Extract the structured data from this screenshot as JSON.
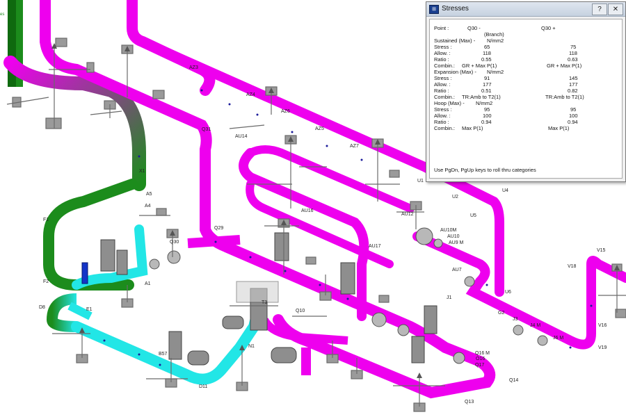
{
  "corner_text": "es",
  "window": {
    "title": "Stresses",
    "help_label": "?",
    "close_label": "✕"
  },
  "stress": {
    "point_label": "Point :",
    "point1": "Q30  -",
    "point2": "Q30  +",
    "branch": "(Branch)",
    "sustained_header": "Sustained (Max) -",
    "sustained_units": "N/mm2",
    "sustained": {
      "stress_label": "Stress :",
      "stress1": "65",
      "stress2": "75",
      "allow_label": "Allow. :",
      "allow1": "118",
      "allow2": "118",
      "ratio_label": "Ratio :",
      "ratio1": "0.55",
      "ratio2": "0.63",
      "combin_label": "Combin.:",
      "combin1": "GR + Max P(1)",
      "combin2": "GR + Max P(1)"
    },
    "expansion_header": "Expansion (Max) -",
    "expansion_units": "N/mm2",
    "expansion": {
      "stress_label": "Stress :",
      "stress1": "91",
      "stress2": "145",
      "allow_label": "Allow. :",
      "allow1": "177",
      "allow2": "177",
      "ratio_label": "Ratio :",
      "ratio1": "0.51",
      "ratio2": "0.82",
      "combin_label": "Combin.:",
      "combin1": "TR:Amb to T2(1)",
      "combin2": "TR:Amb to T2(1)"
    },
    "hoop_header": "Hoop (Max) -",
    "hoop_units": "N/mm2",
    "hoop": {
      "stress_label": "Stress :",
      "stress1": "95",
      "stress2": "95",
      "allow_label": "Allow. :",
      "allow1": "100",
      "allow2": "100",
      "ratio_label": "Ratio :",
      "ratio1": "0.94",
      "ratio2": "0.94",
      "combin_label": "Combin.:",
      "combin1": "Max P(1)",
      "combin2": "Max P(1)"
    },
    "hint": "Use PgDn, PgUp keys to roll thru categories"
  },
  "colors": {
    "magenta": "#ee00ee",
    "green": "#1c8c1c",
    "cyan": "#22e6e6",
    "support_grey": "#7d7d7d"
  },
  "node_labels": [
    "AZ3",
    "AZ4",
    "AZ5",
    "AZ6",
    "AZ7",
    "Q31",
    "Q29",
    "Q30",
    "AU14",
    "AU16",
    "AU17",
    "AU12",
    "AU10M",
    "AU10",
    "AU9 M",
    "AU7",
    "A5",
    "A4",
    "A1",
    "F1",
    "F2",
    "E1",
    "D8",
    "Q10",
    "Q14",
    "Q13",
    "Q16 M",
    "Q17",
    "O16",
    "U1",
    "U2",
    "U4",
    "U5",
    "U6",
    "V15",
    "V16",
    "V18",
    "V19",
    "J1",
    "J3",
    "J4 M",
    "J6 M",
    "G2",
    "N1",
    "D11",
    "B57",
    "T3",
    "X1"
  ]
}
